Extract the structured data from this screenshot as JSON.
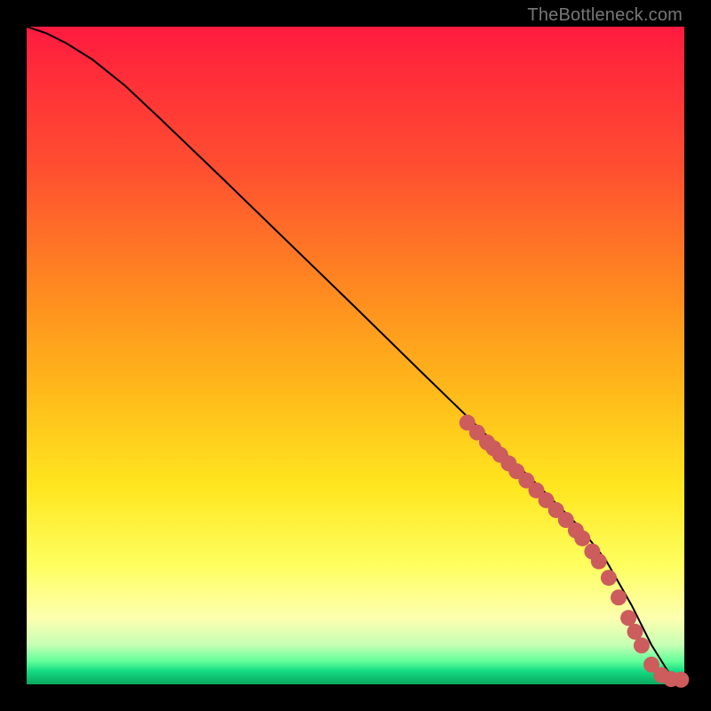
{
  "watermark": "TheBottleneck.com",
  "colors": {
    "page_bg": "#000000",
    "curve": "#000000",
    "dot": "#cd5c5c",
    "gradient_top": "#ff1a40",
    "gradient_mid": "#ffe61f",
    "gradient_bottom": "#0aa85e"
  },
  "chart_data": {
    "type": "line",
    "title": "",
    "xlabel": "",
    "ylabel": "",
    "xlim": [
      0,
      100
    ],
    "ylim": [
      0,
      100
    ],
    "grid": false,
    "legend": false,
    "series": [
      {
        "name": "curve",
        "x": [
          0,
          3,
          6,
          10,
          15,
          20,
          30,
          40,
          50,
          60,
          70,
          78,
          84,
          88,
          92,
          95,
          98,
          100
        ],
        "y": [
          100,
          99,
          97.5,
          95,
          91,
          86.3,
          76.7,
          67,
          57.3,
          47.5,
          37.8,
          30,
          24,
          19,
          12,
          6,
          1.2,
          0.6
        ]
      }
    ],
    "scatter": {
      "name": "highlight-points",
      "x": [
        67,
        68.5,
        70,
        71,
        72,
        73.3,
        74.5,
        76,
        77.5,
        79,
        80.5,
        82,
        83.5,
        84.5,
        86,
        87,
        88.5,
        90,
        91.5,
        92.5,
        93.5,
        95,
        96.5,
        98,
        99.5
      ],
      "y": [
        39.8,
        38.3,
        36.8,
        35.9,
        34.9,
        33.6,
        32.4,
        31,
        29.5,
        28,
        26.5,
        25,
        23.4,
        22.2,
        20.2,
        18.7,
        16.2,
        13.2,
        10.1,
        8,
        5.9,
        3,
        1.4,
        0.8,
        0.7
      ]
    }
  }
}
